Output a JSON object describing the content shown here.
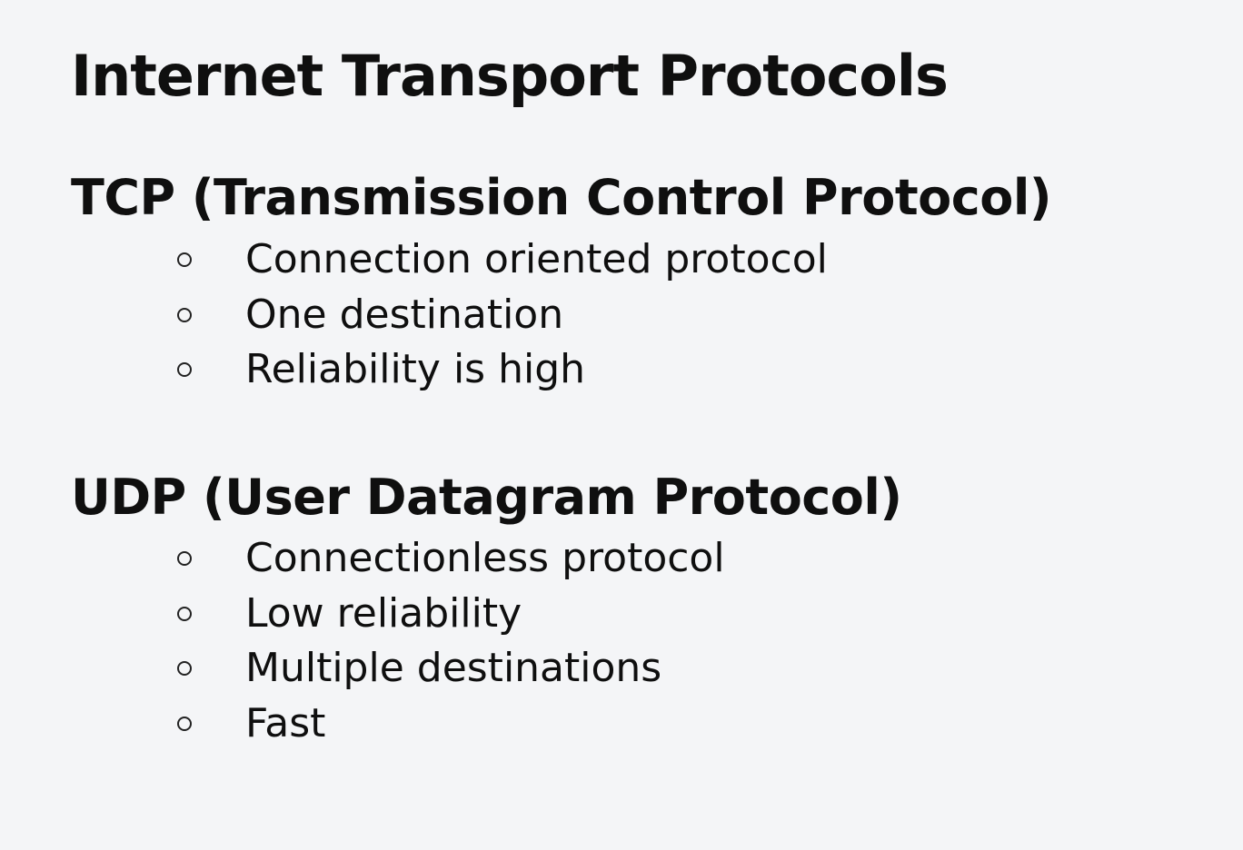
{
  "title": "Internet Transport Protocols",
  "sections": [
    {
      "heading": "TCP (Transmission Control Protocol)",
      "items": [
        "Connection oriented protocol",
        "One destination",
        "Reliability is high"
      ]
    },
    {
      "heading": "UDP (User Datagram Protocol)",
      "items": [
        "Connectionless protocol",
        "Low reliability",
        "Multiple destinations",
        "Fast"
      ]
    }
  ],
  "bullet_icon": "hollow-circle-bullet-icon"
}
